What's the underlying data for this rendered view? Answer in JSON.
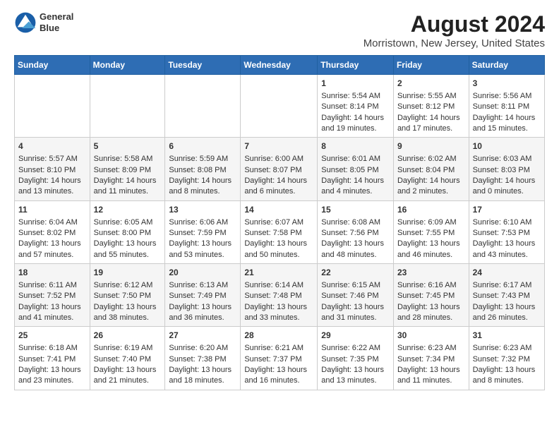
{
  "header": {
    "logo_line1": "General",
    "logo_line2": "Blue",
    "title": "August 2024",
    "subtitle": "Morristown, New Jersey, United States"
  },
  "weekdays": [
    "Sunday",
    "Monday",
    "Tuesday",
    "Wednesday",
    "Thursday",
    "Friday",
    "Saturday"
  ],
  "weeks": [
    [
      {
        "day": "",
        "info": ""
      },
      {
        "day": "",
        "info": ""
      },
      {
        "day": "",
        "info": ""
      },
      {
        "day": "",
        "info": ""
      },
      {
        "day": "1",
        "info": "Sunrise: 5:54 AM\nSunset: 8:14 PM\nDaylight: 14 hours\nand 19 minutes."
      },
      {
        "day": "2",
        "info": "Sunrise: 5:55 AM\nSunset: 8:12 PM\nDaylight: 14 hours\nand 17 minutes."
      },
      {
        "day": "3",
        "info": "Sunrise: 5:56 AM\nSunset: 8:11 PM\nDaylight: 14 hours\nand 15 minutes."
      }
    ],
    [
      {
        "day": "4",
        "info": "Sunrise: 5:57 AM\nSunset: 8:10 PM\nDaylight: 14 hours\nand 13 minutes."
      },
      {
        "day": "5",
        "info": "Sunrise: 5:58 AM\nSunset: 8:09 PM\nDaylight: 14 hours\nand 11 minutes."
      },
      {
        "day": "6",
        "info": "Sunrise: 5:59 AM\nSunset: 8:08 PM\nDaylight: 14 hours\nand 8 minutes."
      },
      {
        "day": "7",
        "info": "Sunrise: 6:00 AM\nSunset: 8:07 PM\nDaylight: 14 hours\nand 6 minutes."
      },
      {
        "day": "8",
        "info": "Sunrise: 6:01 AM\nSunset: 8:05 PM\nDaylight: 14 hours\nand 4 minutes."
      },
      {
        "day": "9",
        "info": "Sunrise: 6:02 AM\nSunset: 8:04 PM\nDaylight: 14 hours\nand 2 minutes."
      },
      {
        "day": "10",
        "info": "Sunrise: 6:03 AM\nSunset: 8:03 PM\nDaylight: 14 hours\nand 0 minutes."
      }
    ],
    [
      {
        "day": "11",
        "info": "Sunrise: 6:04 AM\nSunset: 8:02 PM\nDaylight: 13 hours\nand 57 minutes."
      },
      {
        "day": "12",
        "info": "Sunrise: 6:05 AM\nSunset: 8:00 PM\nDaylight: 13 hours\nand 55 minutes."
      },
      {
        "day": "13",
        "info": "Sunrise: 6:06 AM\nSunset: 7:59 PM\nDaylight: 13 hours\nand 53 minutes."
      },
      {
        "day": "14",
        "info": "Sunrise: 6:07 AM\nSunset: 7:58 PM\nDaylight: 13 hours\nand 50 minutes."
      },
      {
        "day": "15",
        "info": "Sunrise: 6:08 AM\nSunset: 7:56 PM\nDaylight: 13 hours\nand 48 minutes."
      },
      {
        "day": "16",
        "info": "Sunrise: 6:09 AM\nSunset: 7:55 PM\nDaylight: 13 hours\nand 46 minutes."
      },
      {
        "day": "17",
        "info": "Sunrise: 6:10 AM\nSunset: 7:53 PM\nDaylight: 13 hours\nand 43 minutes."
      }
    ],
    [
      {
        "day": "18",
        "info": "Sunrise: 6:11 AM\nSunset: 7:52 PM\nDaylight: 13 hours\nand 41 minutes."
      },
      {
        "day": "19",
        "info": "Sunrise: 6:12 AM\nSunset: 7:50 PM\nDaylight: 13 hours\nand 38 minutes."
      },
      {
        "day": "20",
        "info": "Sunrise: 6:13 AM\nSunset: 7:49 PM\nDaylight: 13 hours\nand 36 minutes."
      },
      {
        "day": "21",
        "info": "Sunrise: 6:14 AM\nSunset: 7:48 PM\nDaylight: 13 hours\nand 33 minutes."
      },
      {
        "day": "22",
        "info": "Sunrise: 6:15 AM\nSunset: 7:46 PM\nDaylight: 13 hours\nand 31 minutes."
      },
      {
        "day": "23",
        "info": "Sunrise: 6:16 AM\nSunset: 7:45 PM\nDaylight: 13 hours\nand 28 minutes."
      },
      {
        "day": "24",
        "info": "Sunrise: 6:17 AM\nSunset: 7:43 PM\nDaylight: 13 hours\nand 26 minutes."
      }
    ],
    [
      {
        "day": "25",
        "info": "Sunrise: 6:18 AM\nSunset: 7:41 PM\nDaylight: 13 hours\nand 23 minutes."
      },
      {
        "day": "26",
        "info": "Sunrise: 6:19 AM\nSunset: 7:40 PM\nDaylight: 13 hours\nand 21 minutes."
      },
      {
        "day": "27",
        "info": "Sunrise: 6:20 AM\nSunset: 7:38 PM\nDaylight: 13 hours\nand 18 minutes."
      },
      {
        "day": "28",
        "info": "Sunrise: 6:21 AM\nSunset: 7:37 PM\nDaylight: 13 hours\nand 16 minutes."
      },
      {
        "day": "29",
        "info": "Sunrise: 6:22 AM\nSunset: 7:35 PM\nDaylight: 13 hours\nand 13 minutes."
      },
      {
        "day": "30",
        "info": "Sunrise: 6:23 AM\nSunset: 7:34 PM\nDaylight: 13 hours\nand 11 minutes."
      },
      {
        "day": "31",
        "info": "Sunrise: 6:23 AM\nSunset: 7:32 PM\nDaylight: 13 hours\nand 8 minutes."
      }
    ]
  ]
}
